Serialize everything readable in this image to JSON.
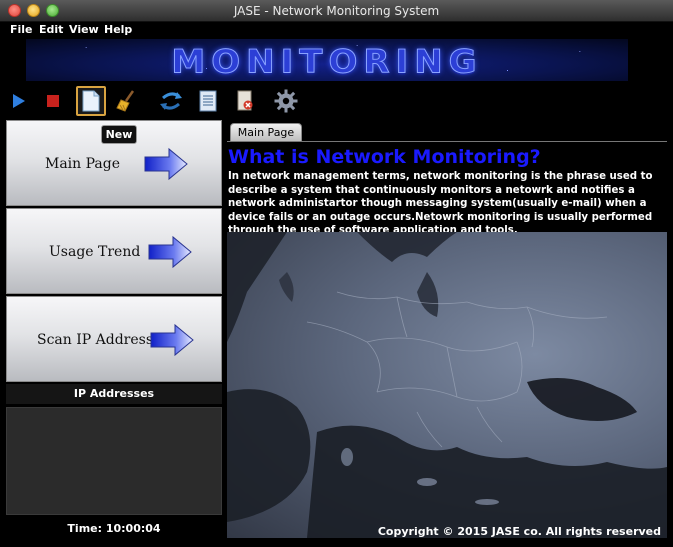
{
  "window": {
    "title": "JASE - Network Monitoring System"
  },
  "menu": {
    "items": [
      "File",
      "Edit",
      "View",
      "Help"
    ]
  },
  "banner": {
    "text": "MONITORING"
  },
  "toolbar": {
    "buttons": [
      {
        "icon": "play-icon"
      },
      {
        "icon": "stop-icon"
      },
      {
        "icon": "new-document-icon",
        "active": true
      },
      {
        "icon": "broom-icon"
      },
      {
        "icon": "refresh-icon"
      },
      {
        "icon": "document-list-icon"
      },
      {
        "icon": "delete-icon"
      },
      {
        "icon": "gear-icon"
      }
    ],
    "tooltip": "New"
  },
  "sidebar": {
    "nav": [
      {
        "label": "Main Page"
      },
      {
        "label": "Usage Trend"
      },
      {
        "label": "Scan IP Address"
      }
    ],
    "ip_header": "IP Addresses",
    "time_label": "Time: 10:00:04"
  },
  "main": {
    "tab": "Main Page",
    "heading": "What is Network Monitoring?",
    "body": "In network management terms, network monitoring is the phrase used to describe a system that continuously monitors a netowrk and notifies a network administartor though messaging system(usually e-mail) when a device fails or an outage occurs.Netowrk monitoring is usually performed through the use of software application and tools.",
    "copyright": "Copyright © 2015 JASE co.  All rights reserved"
  },
  "colors": {
    "heading": "#1a1aff",
    "banner": "#2c3fd6",
    "toolbar_active_border": "#d9a441"
  }
}
